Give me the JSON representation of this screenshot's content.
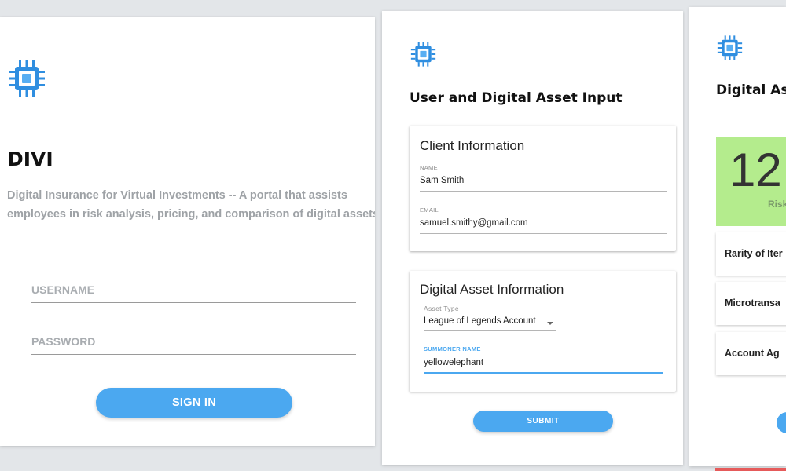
{
  "login": {
    "title": "DIVI",
    "description_line1": "Digital Insurance for Virtual Investments -- A portal that assists",
    "description_line2": "employees in risk analysis, pricing, and comparison of digital assets",
    "username_placeholder": "USERNAME",
    "password_placeholder": "PASSWORD",
    "signin_label": "SIGN IN"
  },
  "input_page": {
    "title": "User and Digital Asset Input",
    "client_card": {
      "title": "Client Information",
      "name_label": "NAME",
      "name_value": "Sam Smith",
      "email_label": "EMAIL",
      "email_value": "samuel.smithy@gmail.com"
    },
    "asset_card": {
      "title": "Digital Asset Information",
      "asset_type_label": "Asset Type",
      "asset_type_value": "League of Legends Account",
      "summoner_label": "SUMMONER NAME",
      "summoner_value": "yellowelephant"
    },
    "submit_label": "SUBMIT"
  },
  "result_page": {
    "title": "Digital Ass",
    "risk_score": "12",
    "risk_label": "Risk",
    "factors": [
      "Rarity of Iter",
      "Microtransa",
      "Account Ag"
    ]
  },
  "colors": {
    "accent_blue": "#4ba8f0",
    "risk_green": "#b4ec8d",
    "background": "#e3e6e9"
  },
  "icons": {
    "logo": "chip-icon",
    "dropdown": "chevron-down-icon"
  }
}
